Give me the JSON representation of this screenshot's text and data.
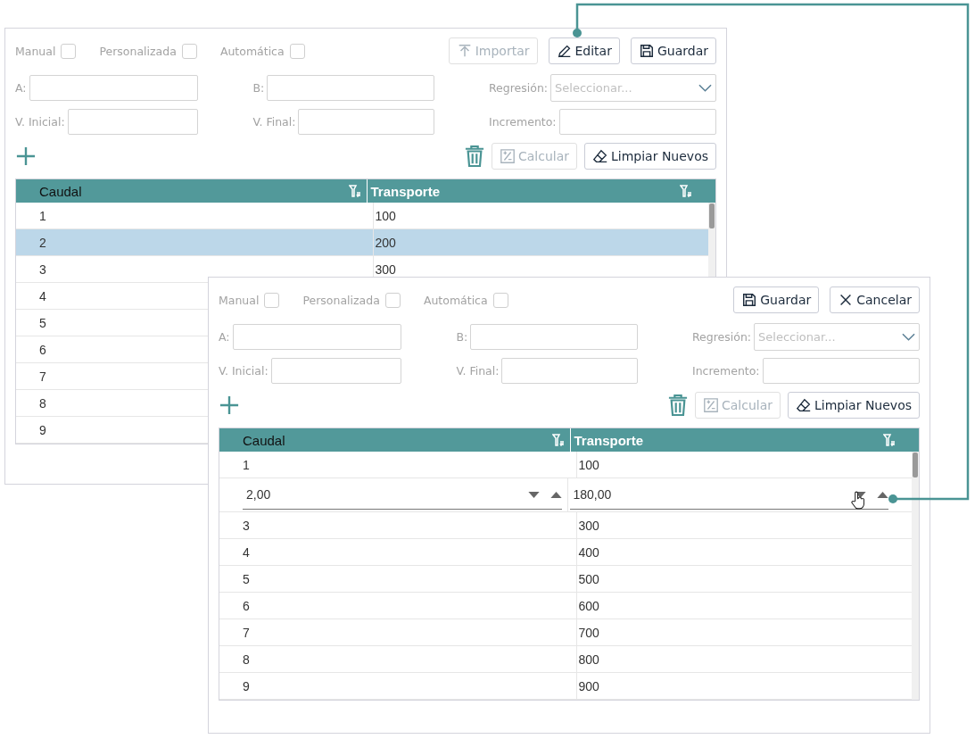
{
  "panels": [
    {
      "checkboxes": [
        {
          "label": "Manual",
          "checked": false
        },
        {
          "label": "Personalizada",
          "checked": false
        },
        {
          "label": "Automática",
          "checked": false
        }
      ],
      "buttons": [
        {
          "kind": "import",
          "label": "Importar",
          "disabled": true
        },
        {
          "kind": "edit",
          "label": "Editar",
          "disabled": false
        },
        {
          "kind": "save",
          "label": "Guardar",
          "disabled": false
        }
      ],
      "fields": {
        "a": "A:",
        "b": "B:",
        "regression": "Regresión:",
        "regression_placeholder": "Seleccionar...",
        "initial": "V. Inicial:",
        "final": "V. Final:",
        "increment": "Incremento:"
      },
      "actions": [
        {
          "kind": "calculate",
          "label": "Calcular",
          "disabled": true
        },
        {
          "kind": "clear",
          "label": "Limpiar Nuevos",
          "disabled": false
        }
      ],
      "columns": [
        {
          "label": "Caudal",
          "selected": true
        },
        {
          "label": "Transporte",
          "selected": false
        }
      ],
      "rows": [
        {
          "cells": [
            "1",
            "100"
          ],
          "selected": false,
          "editing": false
        },
        {
          "cells": [
            "2",
            "200"
          ],
          "selected": true,
          "editing": false
        },
        {
          "cells": [
            "3",
            "300"
          ],
          "selected": false,
          "editing": false
        },
        {
          "cells": [
            "4"
          ],
          "selected": false,
          "editing": false
        },
        {
          "cells": [
            "5"
          ],
          "selected": false,
          "editing": false
        },
        {
          "cells": [
            "6"
          ],
          "selected": false,
          "editing": false
        },
        {
          "cells": [
            "7"
          ],
          "selected": false,
          "editing": false
        },
        {
          "cells": [
            "8"
          ],
          "selected": false,
          "editing": false
        },
        {
          "cells": [
            "9"
          ],
          "selected": false,
          "editing": false
        }
      ]
    },
    {
      "checkboxes": [
        {
          "label": "Manual",
          "checked": false
        },
        {
          "label": "Personalizada",
          "checked": false
        },
        {
          "label": "Automática",
          "checked": false
        }
      ],
      "buttons": [
        {
          "kind": "save",
          "label": "Guardar",
          "disabled": false
        },
        {
          "kind": "cancel",
          "label": "Cancelar",
          "disabled": false
        }
      ],
      "fields": {
        "a": "A:",
        "b": "B:",
        "regression": "Regresión:",
        "regression_placeholder": "Seleccionar...",
        "initial": "V. Inicial:",
        "final": "V. Final:",
        "increment": "Incremento:"
      },
      "actions": [
        {
          "kind": "calculate",
          "label": "Calcular",
          "disabled": true
        },
        {
          "kind": "clear",
          "label": "Limpiar Nuevos",
          "disabled": false
        }
      ],
      "columns": [
        {
          "label": "Caudal",
          "selected": true
        },
        {
          "label": "Transporte",
          "selected": false
        }
      ],
      "rows": [
        {
          "cells": [
            "1",
            "100"
          ],
          "selected": false,
          "editing": false
        },
        {
          "cells": [
            "2,00",
            "180,00"
          ],
          "selected": false,
          "editing": true
        },
        {
          "cells": [
            "3",
            "300"
          ],
          "selected": false,
          "editing": false
        },
        {
          "cells": [
            "4",
            "400"
          ],
          "selected": false,
          "editing": false
        },
        {
          "cells": [
            "5",
            "500"
          ],
          "selected": false,
          "editing": false
        },
        {
          "cells": [
            "6",
            "600"
          ],
          "selected": false,
          "editing": false
        },
        {
          "cells": [
            "7",
            "700"
          ],
          "selected": false,
          "editing": false
        },
        {
          "cells": [
            "8",
            "800"
          ],
          "selected": false,
          "editing": false
        },
        {
          "cells": [
            "9",
            "900"
          ],
          "selected": false,
          "editing": false
        }
      ]
    }
  ]
}
